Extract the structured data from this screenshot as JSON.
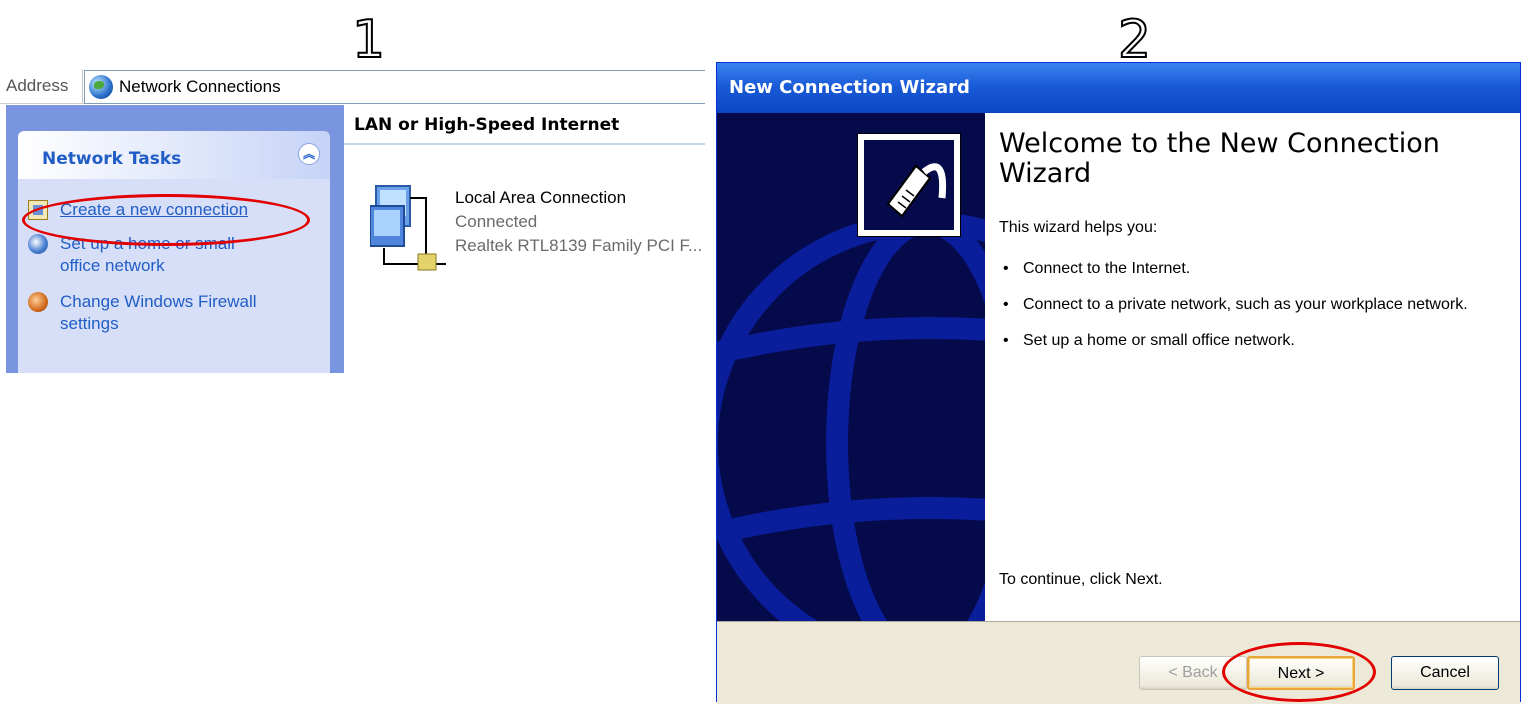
{
  "step_labels": [
    "1",
    "2"
  ],
  "network_connections": {
    "address_label": "Address",
    "address_value": "Network Connections",
    "task_pane": {
      "title": "Network Tasks",
      "items": [
        {
          "label": "Create a new connection",
          "icon": "create-connection-icon",
          "highlighted": true
        },
        {
          "label": "Set up a home or small office network",
          "icon": "home-network-icon"
        },
        {
          "label": "Change Windows Firewall settings",
          "icon": "firewall-icon"
        }
      ]
    },
    "group_title": "LAN or High-Speed Internet",
    "connection": {
      "name": "Local Area Connection",
      "status": "Connected",
      "device": "Realtek RTL8139 Family PCI F..."
    }
  },
  "wizard": {
    "title": "New Connection Wizard",
    "heading": "Welcome to the New Connection Wizard",
    "intro": "This wizard helps you:",
    "bullets": [
      "Connect to the Internet.",
      "Connect to a private network, such as your workplace network.",
      "Set up a home or small office network."
    ],
    "continue_text": "To continue, click Next.",
    "buttons": {
      "back": "< Back",
      "next": "Next >",
      "cancel": "Cancel"
    }
  },
  "colors": {
    "highlight": "#e30000",
    "task_pane_bg": "#7a95e0",
    "title_bar": "#0a46c2",
    "wizard_side": "#050a4a"
  }
}
